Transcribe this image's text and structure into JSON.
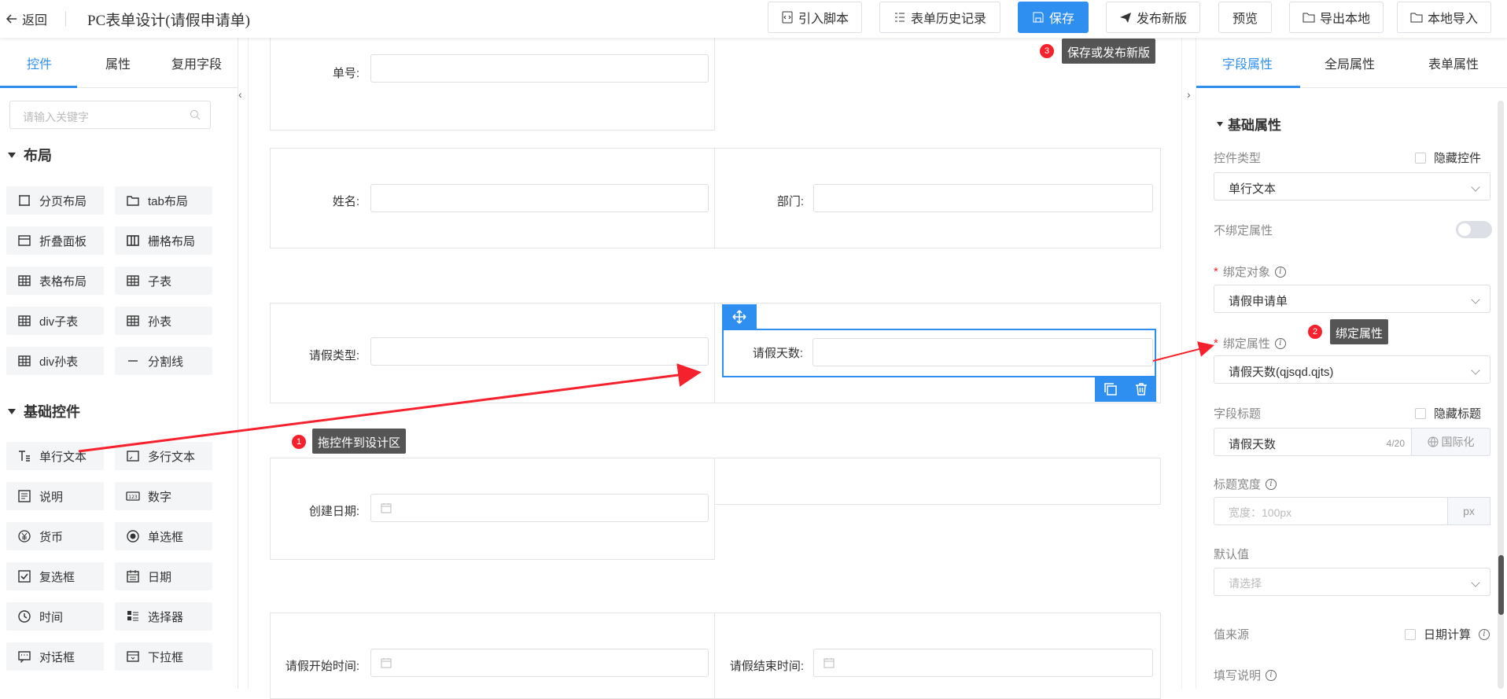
{
  "header": {
    "back_label": "返回",
    "title": "PC表单设计(请假申请单)",
    "buttons": {
      "import_script": "引入脚本",
      "history": "表单历史记录",
      "save": "保存",
      "publish": "发布新版",
      "preview": "预览",
      "export_local": "导出本地",
      "import_local": "本地导入"
    }
  },
  "left": {
    "tabs": [
      "控件",
      "属性",
      "复用字段"
    ],
    "search_placeholder": "请输入关键字",
    "sections": {
      "layout_title": "布局",
      "basic_title": "基础控件"
    },
    "layout_items": [
      {
        "label": "分页布局",
        "icon": "page-layout-icon"
      },
      {
        "label": "tab布局",
        "icon": "tab-layout-icon"
      },
      {
        "label": "折叠面板",
        "icon": "collapse-panel-icon"
      },
      {
        "label": "栅格布局",
        "icon": "grid-layout-icon"
      },
      {
        "label": "表格布局",
        "icon": "table-layout-icon"
      },
      {
        "label": "子表",
        "icon": "subtable-icon"
      },
      {
        "label": "div子表",
        "icon": "div-subtable-icon"
      },
      {
        "label": "孙表",
        "icon": "grandchild-table-icon"
      },
      {
        "label": "div孙表",
        "icon": "div-grandchild-table-icon"
      },
      {
        "label": "分割线",
        "icon": "divider-icon"
      }
    ],
    "basic_items": [
      {
        "label": "单行文本",
        "icon": "single-line-text-icon"
      },
      {
        "label": "多行文本",
        "icon": "multi-line-text-icon"
      },
      {
        "label": "说明",
        "icon": "description-icon"
      },
      {
        "label": "数字",
        "icon": "number-icon"
      },
      {
        "label": "货币",
        "icon": "currency-icon"
      },
      {
        "label": "单选框",
        "icon": "radio-icon"
      },
      {
        "label": "复选框",
        "icon": "checkbox-icon"
      },
      {
        "label": "日期",
        "icon": "calendar-icon"
      },
      {
        "label": "时间",
        "icon": "clock-icon"
      },
      {
        "label": "选择器",
        "icon": "selector-icon"
      },
      {
        "label": "对话框",
        "icon": "dialog-icon"
      },
      {
        "label": "下拉框",
        "icon": "dropdown-icon"
      }
    ]
  },
  "canvas": {
    "fields": {
      "danhao": "单号:",
      "name": "姓名:",
      "dept": "部门:",
      "leave_type": "请假类型:",
      "leave_days": "请假天数:",
      "create_date": "创建日期:",
      "start_time": "请假开始时间:",
      "end_time": "请假结束时间:"
    }
  },
  "right": {
    "tabs": [
      "字段属性",
      "全局属性",
      "表单属性"
    ],
    "section_title": "基础属性",
    "control_type_label": "控件类型",
    "hide_control_label": "隐藏控件",
    "control_type_value": "单行文本",
    "unbind_label": "不绑定属性",
    "bind_object_label": "绑定对象",
    "bind_object_value": "请假申请单",
    "bind_attr_label": "绑定属性",
    "bind_attr_value": "请假天数(qjsqd.qjts)",
    "field_title_label": "字段标题",
    "hide_title_label": "隐藏标题",
    "field_title_value": "请假天数",
    "field_title_count": "4/20",
    "i18n_label": "国际化",
    "title_width_label": "标题宽度",
    "title_width_placeholder": "宽度：100px",
    "title_width_unit": "px",
    "default_value_label": "默认值",
    "default_value_placeholder": "请选择",
    "value_source_label": "值来源",
    "date_calc_label": "日期计算",
    "fill_desc_label": "填写说明"
  },
  "annotations": [
    {
      "number": "1",
      "text": "拖控件到设计区"
    },
    {
      "number": "2",
      "text": "绑定属性"
    },
    {
      "number": "3",
      "text": "保存或发布新版"
    }
  ],
  "colors": {
    "accent": "#2f8ff0",
    "annotation": "#f5222d"
  }
}
